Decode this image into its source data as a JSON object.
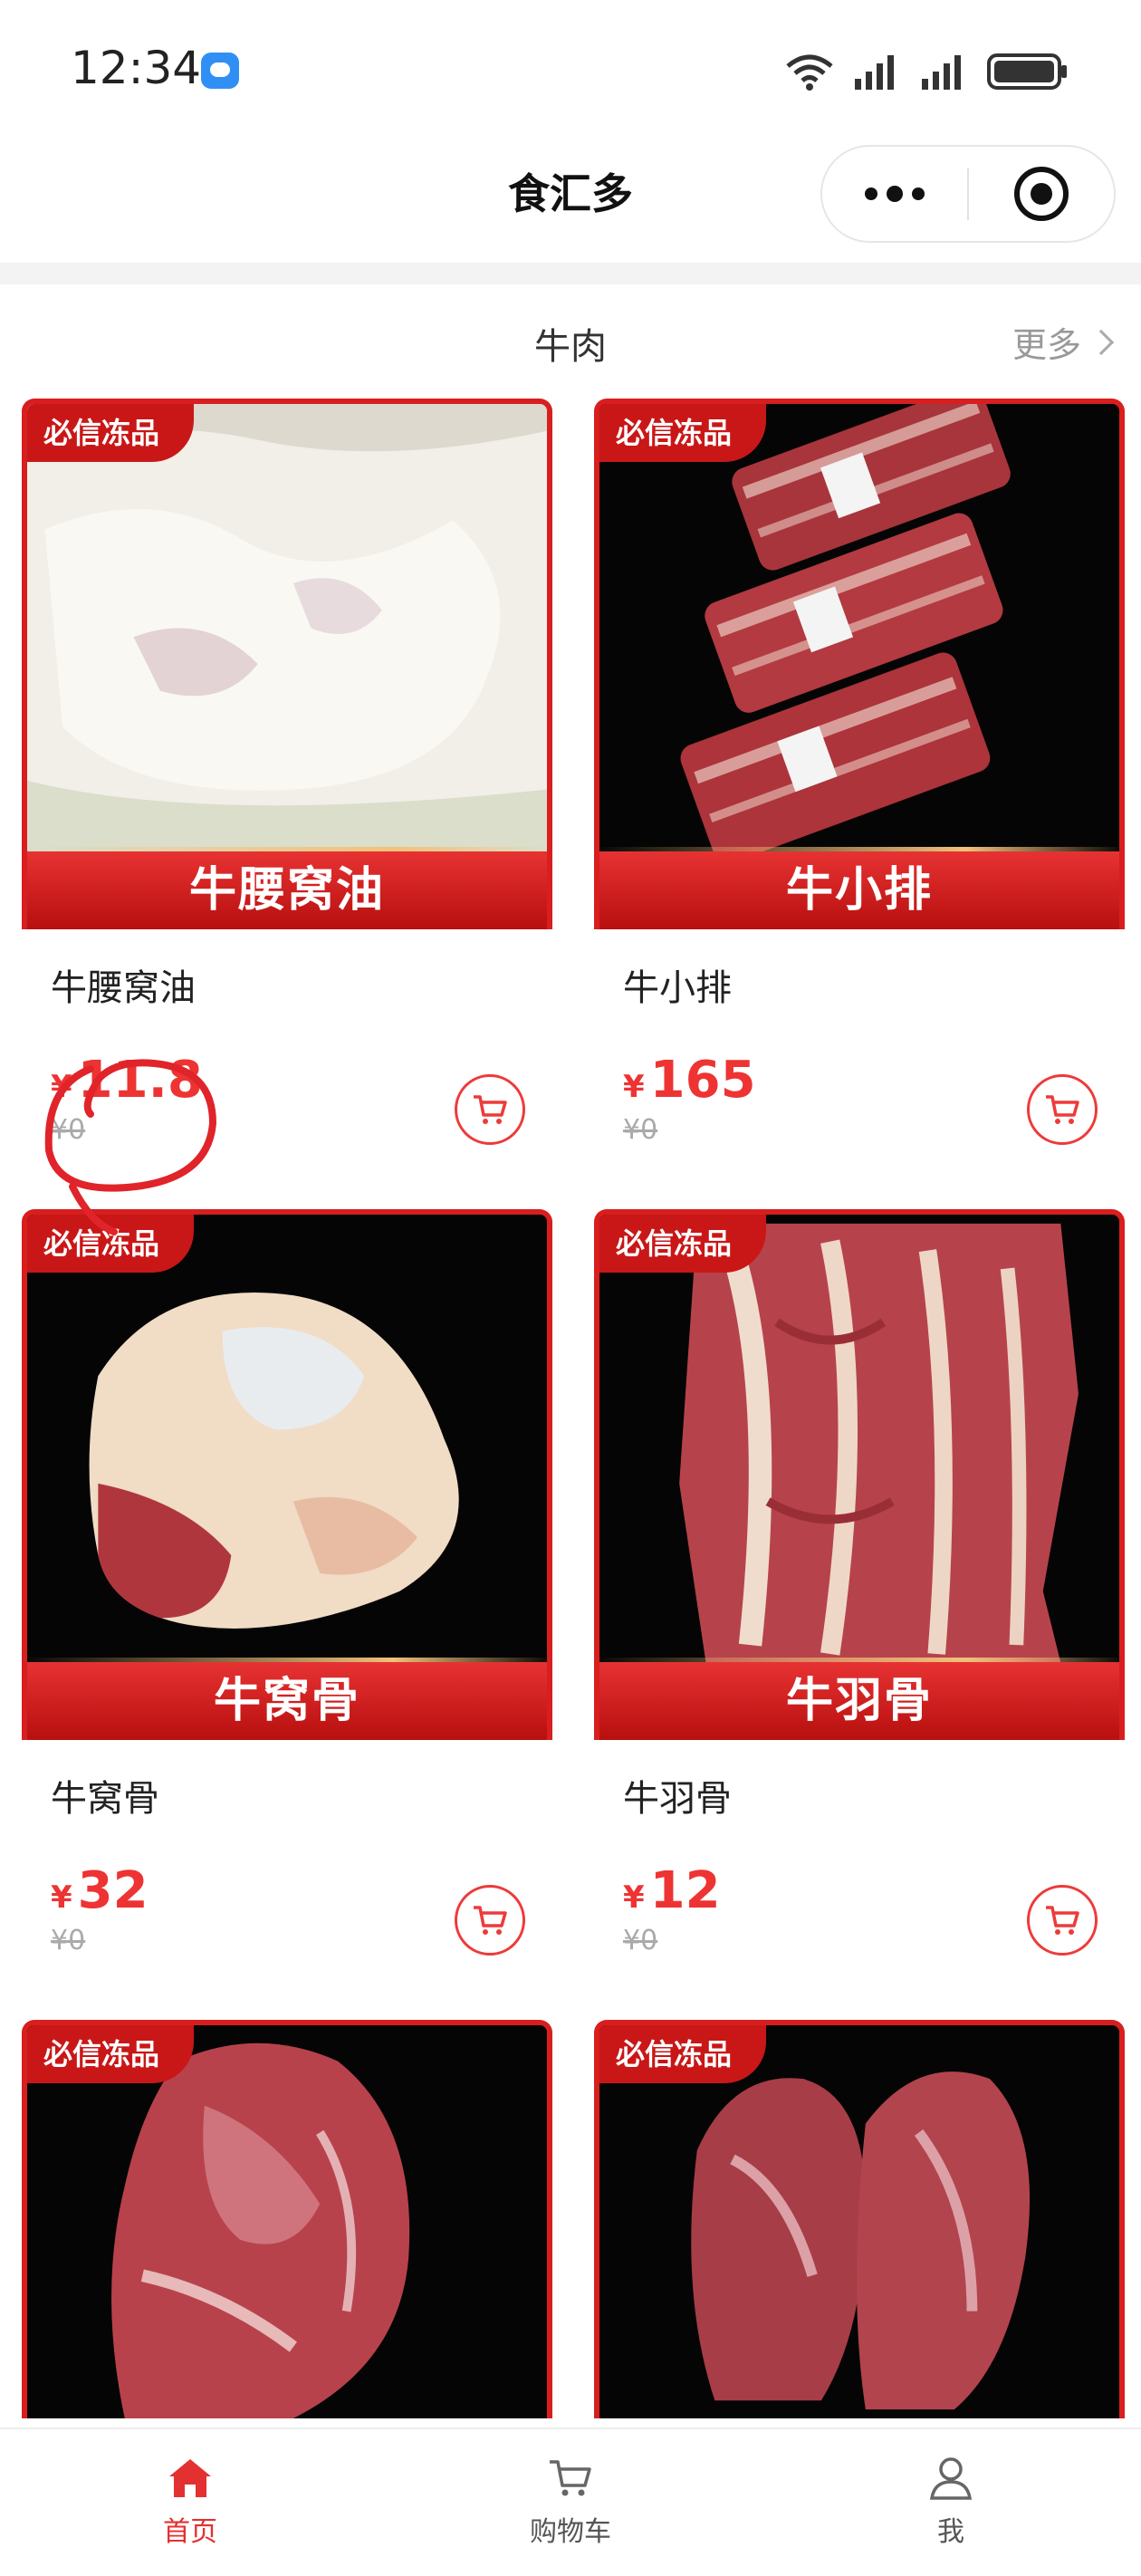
{
  "status_bar": {
    "time": "12:34"
  },
  "nav": {
    "title": "食汇多"
  },
  "section": {
    "title": "牛肉",
    "more_label": "更多"
  },
  "colors": {
    "accent": "#ee3333",
    "brand_red": "#c91717"
  },
  "products": [
    {
      "brand": "必信冻品",
      "banner": "牛腰窝油",
      "name": "牛腰窝油",
      "currency": "¥",
      "price": "11.8",
      "original_price": "¥0"
    },
    {
      "brand": "必信冻品",
      "banner": "牛小排",
      "name": "牛小排",
      "currency": "¥",
      "price": "165",
      "original_price": "¥0"
    },
    {
      "brand": "必信冻品",
      "banner": "牛窝骨",
      "name": "牛窝骨",
      "currency": "¥",
      "price": "32",
      "original_price": "¥0"
    },
    {
      "brand": "必信冻品",
      "banner": "牛羽骨",
      "name": "牛羽骨",
      "currency": "¥",
      "price": "12",
      "original_price": "¥0"
    },
    {
      "brand": "必信冻品"
    },
    {
      "brand": "必信冻品"
    }
  ],
  "tabs": [
    {
      "label": "首页",
      "icon": "home-icon",
      "active": true
    },
    {
      "label": "购物车",
      "icon": "cart-icon",
      "active": false
    },
    {
      "label": "我",
      "icon": "user-icon",
      "active": false
    }
  ]
}
